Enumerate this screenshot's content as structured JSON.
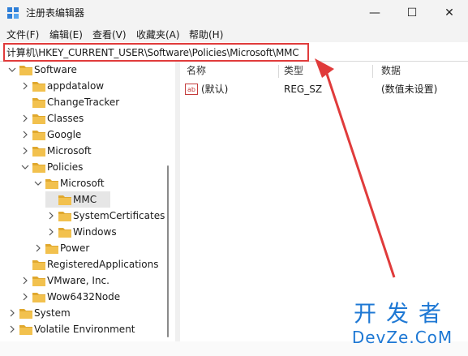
{
  "window": {
    "title": "注册表编辑器",
    "minimize": "—",
    "maximize": "☐",
    "close": "✕"
  },
  "menu": [
    "文件(F)",
    "编辑(E)",
    "查看(V)",
    "收藏夹(A)",
    "帮助(H)"
  ],
  "address": {
    "path": "计算机\\HKEY_CURRENT_USER\\Software\\Policies\\Microsoft\\MMC"
  },
  "tree": [
    {
      "label": "Software",
      "level": 0,
      "expanded": true
    },
    {
      "label": "appdatalow",
      "level": 1,
      "expanded": false
    },
    {
      "label": "ChangeTracker",
      "level": 1,
      "leaf": true
    },
    {
      "label": "Classes",
      "level": 1,
      "expanded": false
    },
    {
      "label": "Google",
      "level": 1,
      "expanded": false
    },
    {
      "label": "Microsoft",
      "level": 1,
      "expanded": false
    },
    {
      "label": "Policies",
      "level": 1,
      "expanded": true
    },
    {
      "label": "Microsoft",
      "level": 2,
      "expanded": true
    },
    {
      "label": "MMC",
      "level": 3,
      "leaf": true,
      "selected": true
    },
    {
      "label": "SystemCertificates",
      "level": 3,
      "expanded": false
    },
    {
      "label": "Windows",
      "level": 3,
      "expanded": false
    },
    {
      "label": "Power",
      "level": 2,
      "expanded": false
    },
    {
      "label": "RegisteredApplications",
      "level": 1,
      "leaf": true
    },
    {
      "label": "VMware, Inc.",
      "level": 1,
      "expanded": false
    },
    {
      "label": "Wow6432Node",
      "level": 1,
      "expanded": false
    },
    {
      "label": "System",
      "level": 0,
      "expanded": false
    },
    {
      "label": "Volatile Environment",
      "level": 0,
      "expanded": false
    }
  ],
  "list": {
    "columns": [
      "名称",
      "类型",
      "数据"
    ],
    "rows": [
      {
        "icon": "ab",
        "name": "(默认)",
        "type": "REG_SZ",
        "data": "(数值未设置)"
      }
    ]
  },
  "watermark": {
    "line1": "开发者",
    "line2": "DevZe.CoM"
  },
  "colors": {
    "annotation": "#e03b3b",
    "folder": "#f2c14e",
    "watermark": "#1e78d4"
  }
}
